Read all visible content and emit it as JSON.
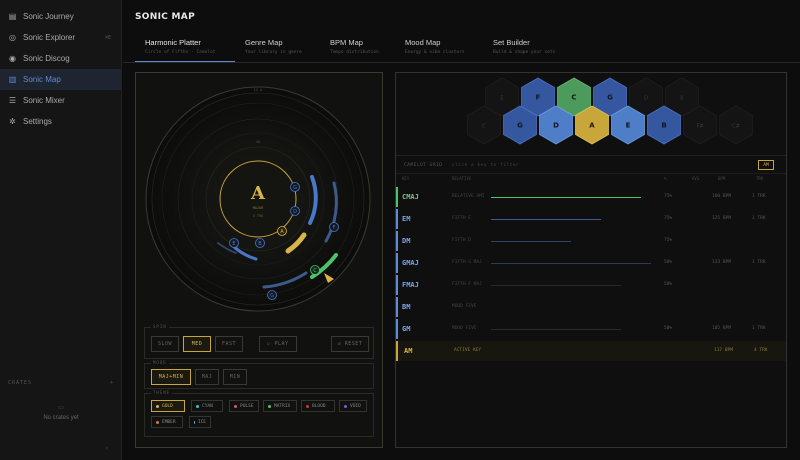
{
  "sidebar": {
    "items": [
      {
        "label": "Sonic Journey",
        "icon": "book-icon"
      },
      {
        "label": "Sonic Explorer",
        "icon": "compass-icon",
        "badge": "⌘E"
      },
      {
        "label": "Sonic Discog",
        "icon": "disc-icon"
      },
      {
        "label": "Sonic Map",
        "icon": "map-icon",
        "active": true
      },
      {
        "label": "Sonic Mixer",
        "icon": "sliders-icon"
      },
      {
        "label": "Settings",
        "icon": "gear-icon"
      }
    ],
    "crates_label": "CRATES",
    "crates_add": "+",
    "crates_icon": "▭",
    "crates_empty": "No crates yet",
    "collapse": "‹"
  },
  "main": {
    "title": "SONIC MAP",
    "tabs": [
      {
        "label": "Harmonic Platter",
        "sub": "Circle of Fifths · Camelot",
        "active": true
      },
      {
        "label": "Genre Map",
        "sub": "Your library in genre"
      },
      {
        "label": "BPM Map",
        "sub": "Tempo distribution"
      },
      {
        "label": "Mood Map",
        "sub": "Energy & vibe clusters"
      },
      {
        "label": "Set Builder",
        "sub": "Build & shape your sets"
      }
    ]
  },
  "platter": {
    "center_key": "A",
    "center_sub": "MAJOR",
    "center_count": "4 TRK",
    "top_label": "12 A",
    "inner_label": "4A",
    "orbit_keys": [
      "G",
      "D",
      "A",
      "E",
      "B",
      "F",
      "C",
      "G",
      "E",
      "B"
    ]
  },
  "controls": {
    "spin_label": "SPIN",
    "spin_buttons": [
      "SLOW",
      "MED",
      "FAST"
    ],
    "spin_active": "MED",
    "play_label": "▷ PLAY",
    "reset_label": "↺ RESET",
    "mode_label": "MODE",
    "mode_buttons": [
      "MAJ+MIN",
      "MAJ",
      "MIN"
    ],
    "mode_active": "MAJ+MIN",
    "theme_label": "THEME",
    "themes": [
      {
        "label": "GOLD",
        "color": "#d7b548",
        "active": true
      },
      {
        "label": "CYAN",
        "color": "#3fc1d3"
      },
      {
        "label": "PULSE",
        "color": "#d0587a"
      },
      {
        "label": "MATRIX",
        "color": "#4cc36a"
      },
      {
        "label": "BLOOD",
        "color": "#c23a3a"
      },
      {
        "label": "VOID",
        "color": "#8a5ad0"
      },
      {
        "label": "EMBER",
        "color": "#d07a3a"
      },
      {
        "label": "ICE",
        "color": "#7ab8e0"
      }
    ]
  },
  "hexmap": {
    "top_row": [
      {
        "label": "E",
        "kind": "ghost"
      },
      {
        "label": "F",
        "kind": "blue"
      },
      {
        "label": "C",
        "kind": "green"
      },
      {
        "label": "G",
        "kind": "blue"
      },
      {
        "label": "D",
        "kind": "ghost"
      },
      {
        "label": "B",
        "kind": "ghost"
      }
    ],
    "bottom_row": [
      {
        "label": "C",
        "kind": "ghost"
      },
      {
        "label": "G",
        "kind": "blue"
      },
      {
        "label": "D",
        "kind": "lightblue"
      },
      {
        "label": "A",
        "kind": "gold"
      },
      {
        "label": "E",
        "kind": "lightblue"
      },
      {
        "label": "B",
        "kind": "blue"
      },
      {
        "label": "F#",
        "kind": "ghost"
      },
      {
        "label": "C#",
        "kind": "ghost"
      }
    ]
  },
  "table": {
    "title": "CAMELOT GRID",
    "subtitle": "click a key to filter",
    "toggle": "AM",
    "headers": [
      "KEY",
      "RELATIVE",
      "",
      "%",
      "AVG",
      "BPM",
      "TRK"
    ],
    "rows": [
      {
        "key": "CMAJ",
        "name": "RELATIVE AMI",
        "pct": "75%",
        "bpm": "100 BPM",
        "trk": "1 TRK",
        "color": "#7fbf8a",
        "accent": "#4cc36a",
        "bar": "#4cc36a",
        "barw": 150
      },
      {
        "key": "EM",
        "name": "FIFTH E",
        "pct": "75%",
        "bpm": "125 BPM",
        "trk": "1 TRK",
        "color": "#7aa5e6",
        "accent": "#5e8bd6",
        "bar": "#3c5a8a",
        "barw": 110
      },
      {
        "key": "DM",
        "name": "FIFTH D",
        "pct": "75%",
        "bpm": "",
        "trk": "",
        "color": "#7aa5e6",
        "accent": "#5e8bd6",
        "bar": "#2e4468",
        "barw": 80
      },
      {
        "key": "GMAJ",
        "name": "FIFTH G MAJ",
        "pct": "50%",
        "bpm": "133 BPM",
        "trk": "1 TRK",
        "color": "#7aa5e6",
        "accent": "#5e8bd6",
        "bar": "#2e3a4e",
        "barw": 160
      },
      {
        "key": "FMAJ",
        "name": "FIFTH F MAJ",
        "pct": "50%",
        "bpm": "",
        "trk": "",
        "color": "#7aa5e6",
        "accent": "#5e8bd6",
        "bar": "#2a2a2a",
        "barw": 130
      },
      {
        "key": "BM",
        "name": "MOOD FIVE",
        "pct": "",
        "bpm": "",
        "trk": "",
        "color": "#7aa5e6",
        "accent": "#5e8bd6",
        "bar": "#222",
        "barw": 0
      },
      {
        "key": "GM",
        "name": "MOOD FIVE",
        "pct": "50%",
        "bpm": "105 BPM",
        "trk": "1 TRK",
        "color": "#7aa5e6",
        "accent": "#5e8bd6",
        "bar": "#2a2a2a",
        "barw": 130
      },
      {
        "key": "AM",
        "name": "ACTIVE KEY",
        "pct": "",
        "bpm": "117 BPM",
        "trk": "4 TRK",
        "color": "#d7b548",
        "accent": "#c9a63a",
        "bar": "",
        "barw": 0,
        "active": true
      }
    ]
  }
}
